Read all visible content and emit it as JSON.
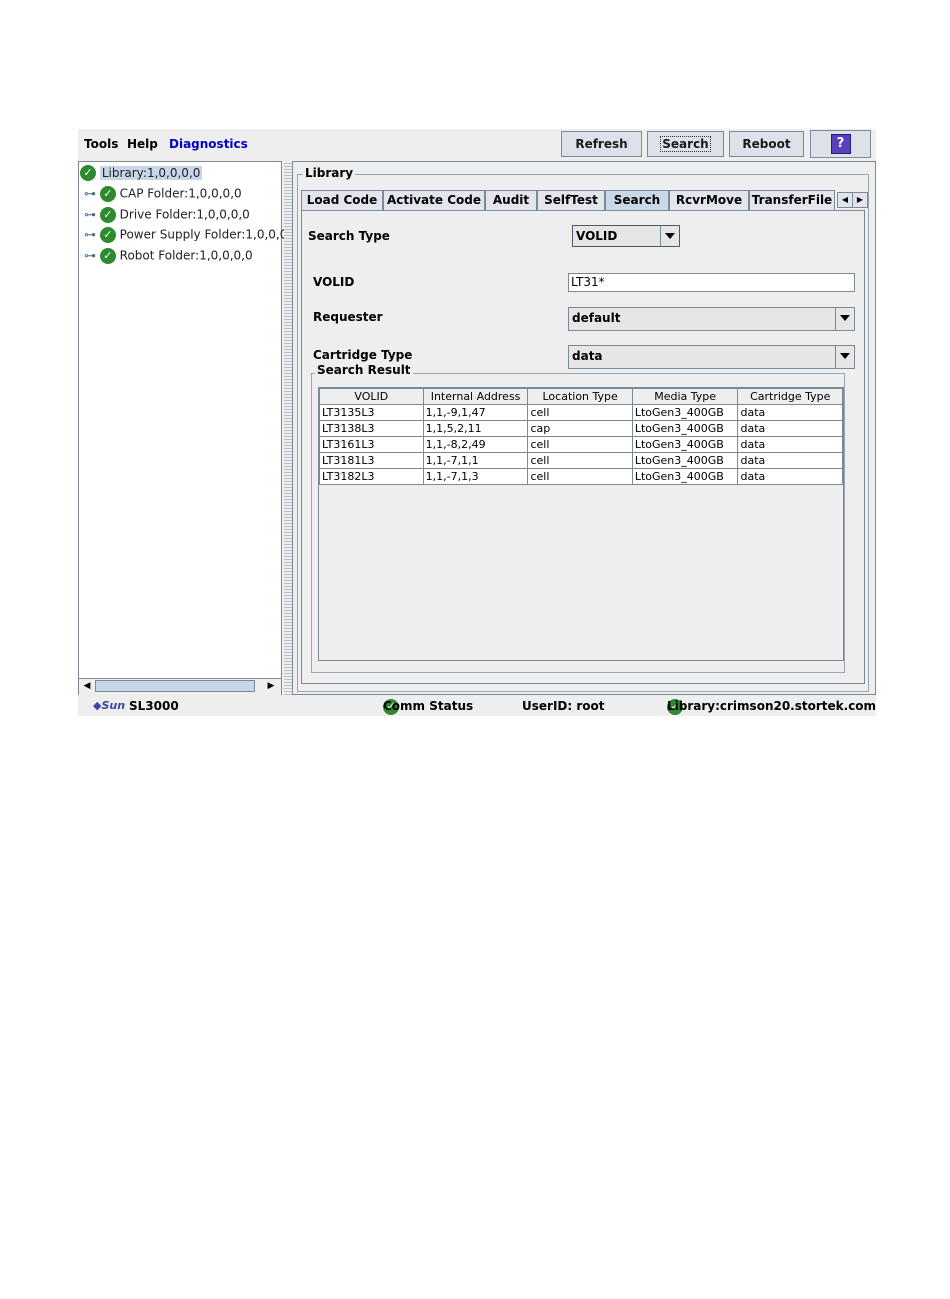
{
  "menu": {
    "tools": "Tools",
    "help": "Help",
    "diagnostics": "Diagnostics"
  },
  "toolbar": {
    "refresh": "Refresh",
    "search": "Search",
    "reboot": "Reboot",
    "help_icon": "?"
  },
  "tree": {
    "root": "Library:1,0,0,0,0",
    "items": [
      "CAP Folder:1,0,0,0,0",
      "Drive Folder:1,0,0,0,0",
      "Power Supply Folder:1,0,0,0,",
      "Robot Folder:1,0,0,0,0"
    ]
  },
  "panel": {
    "title": "Library"
  },
  "tabs": [
    "Load Code",
    "Activate Code",
    "Audit",
    "SelfTest",
    "Search",
    "RcvrMove",
    "TransferFile"
  ],
  "search": {
    "search_type_label": "Search Type",
    "search_type_value": "VOLID",
    "volid_label": "VOLID",
    "volid_value": "LT31*",
    "requester_label": "Requester",
    "requester_value": "default",
    "cartridge_label": "Cartridge Type",
    "cartridge_value": "data"
  },
  "result": {
    "title": "Search Result",
    "columns": [
      "VOLID",
      "Internal Address",
      "Location Type",
      "Media Type",
      "Cartridge Type"
    ],
    "rows": [
      [
        "LT3135L3",
        "1,1,-9,1,47",
        "cell",
        "LtoGen3_400GB",
        "data"
      ],
      [
        "LT3138L3",
        "1,1,5,2,11",
        "cap",
        "LtoGen3_400GB",
        "data"
      ],
      [
        "LT3161L3",
        "1,1,-8,2,49",
        "cell",
        "LtoGen3_400GB",
        "data"
      ],
      [
        "LT3181L3",
        "1,1,-7,1,1",
        "cell",
        "LtoGen3_400GB",
        "data"
      ],
      [
        "LT3182L3",
        "1,1,-7,1,3",
        "cell",
        "LtoGen3_400GB",
        "data"
      ]
    ]
  },
  "status": {
    "logo": "Sun",
    "product": "SL3000",
    "comm": "Comm Status",
    "user": "UserID: root",
    "library": "Library:crimson20.stortek.com"
  },
  "colors": {
    "check": "#2e8a2e",
    "diagnostics": "#0000cc",
    "help_button": "#5a3fbf"
  },
  "icons": {
    "status_ok": "check-circle-icon",
    "tree_node": "tree-connector-icon"
  }
}
